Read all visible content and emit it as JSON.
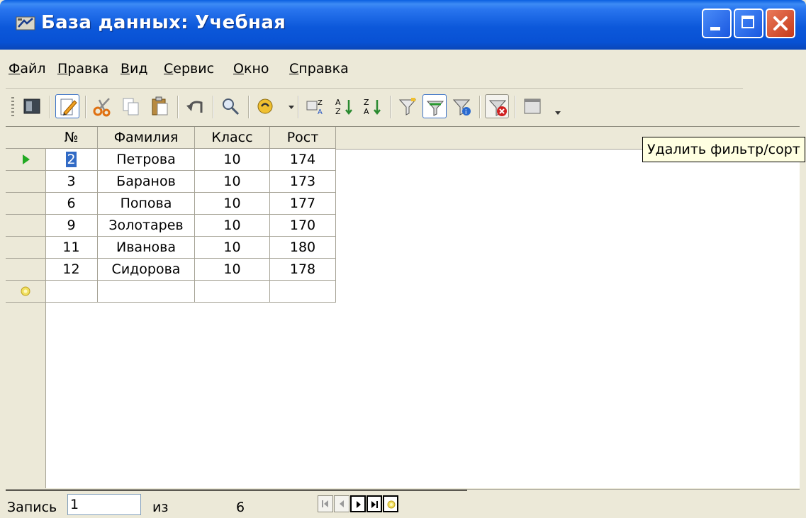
{
  "window": {
    "title": "База данных: Учебная"
  },
  "menu": {
    "items": [
      "Файл",
      "Правка",
      "Вид",
      "Сервис",
      "Окно",
      "Справка"
    ]
  },
  "toolbar": {
    "tooltip": "Удалить фильтр/сорт"
  },
  "table": {
    "columns": [
      "№",
      "Фамилия",
      "Класс",
      "Рост"
    ],
    "rows": [
      [
        "2",
        "Петрова",
        "10",
        "174"
      ],
      [
        "3",
        "Баранов",
        "10",
        "173"
      ],
      [
        "6",
        "Попова",
        "10",
        "177"
      ],
      [
        "9",
        "Золотарев",
        "10",
        "170"
      ],
      [
        "11",
        "Иванова",
        "10",
        "180"
      ],
      [
        "12",
        "Сидорова",
        "10",
        "178"
      ]
    ]
  },
  "status": {
    "record_label": "Запись",
    "record_value": "1",
    "of_label": "из",
    "total": "6"
  },
  "colors": {
    "title_bar": "#0c58da",
    "face": "#ece9d8",
    "selection": "#316ac5",
    "tooltip_bg": "#ffffe1"
  }
}
